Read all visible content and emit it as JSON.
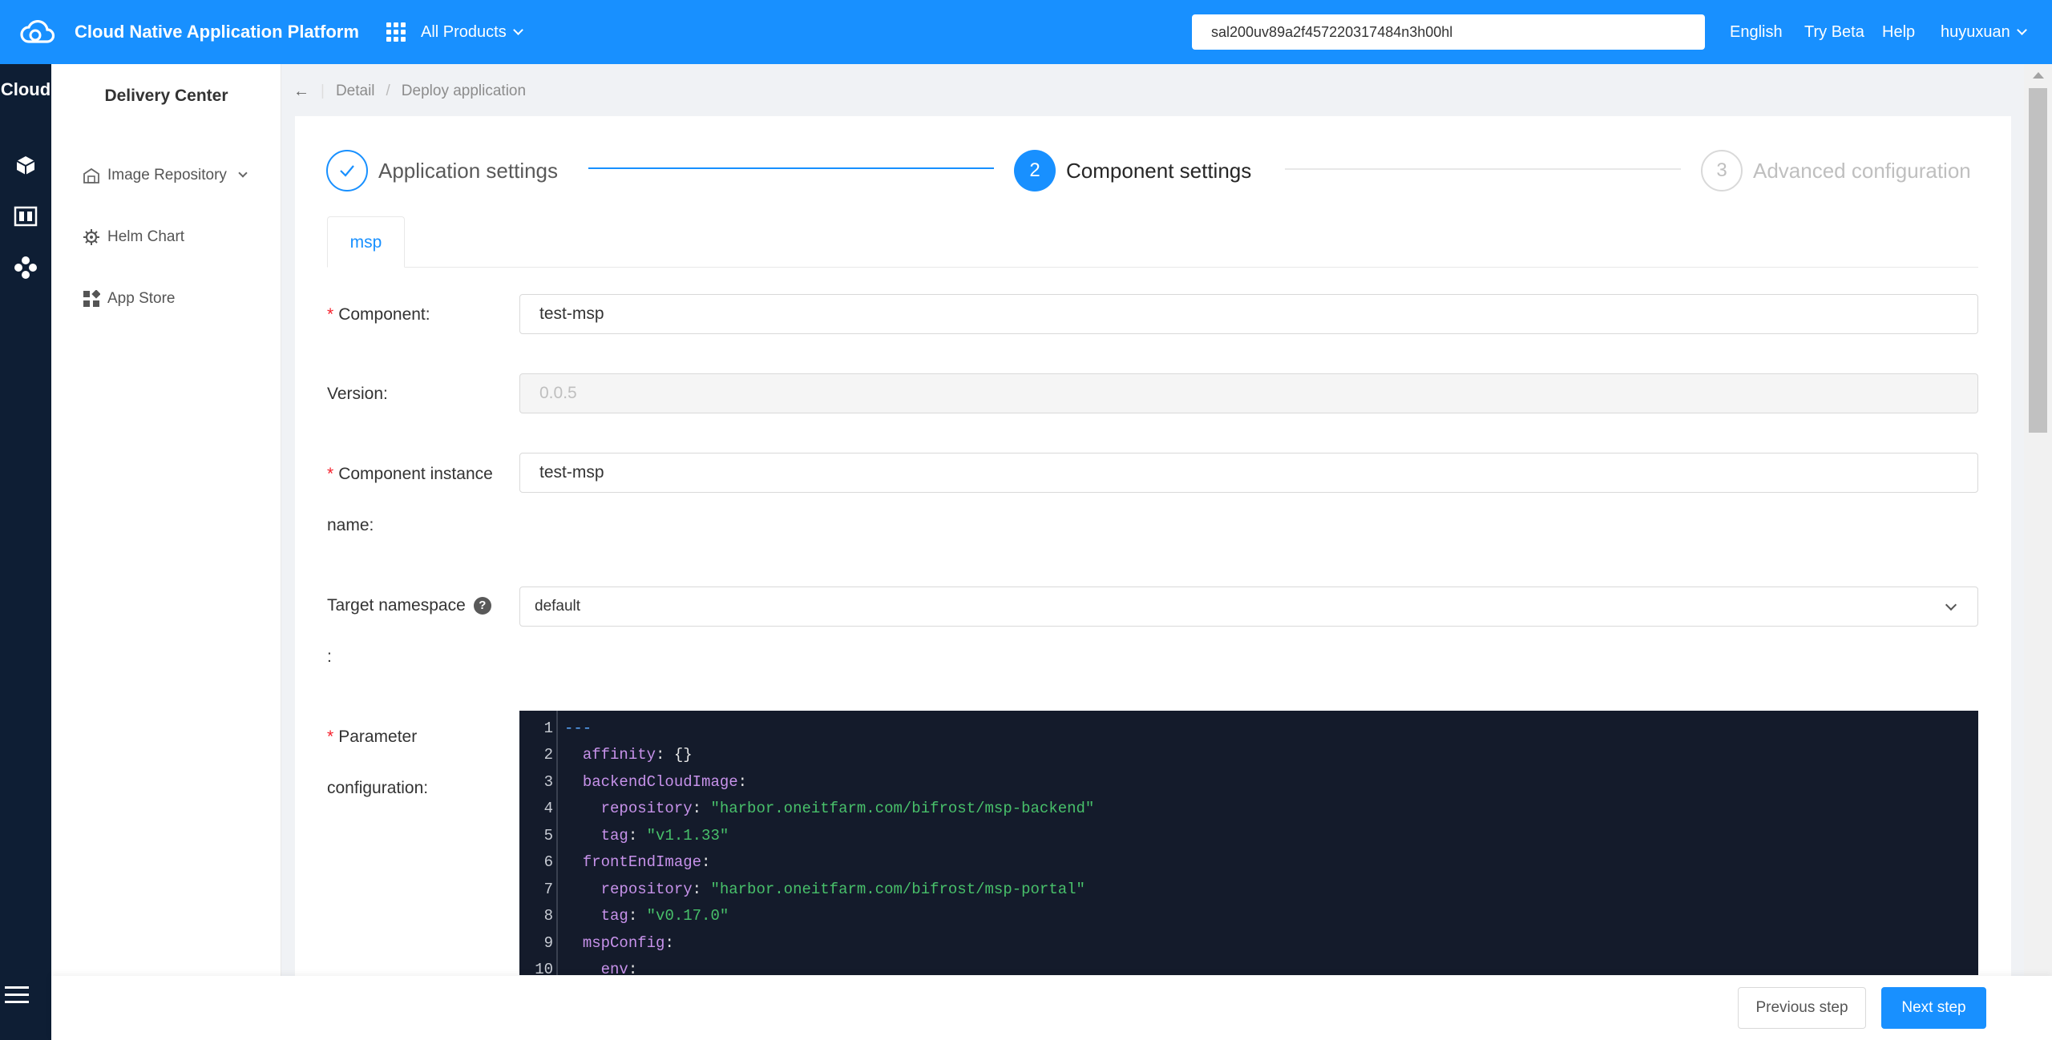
{
  "topbar": {
    "title": "Cloud Native Application Platform",
    "products_label": "All Products",
    "search_value": "sal200uv89a2f457220317484n3h00hl",
    "language": "English",
    "try_beta": "Try Beta",
    "help": "Help",
    "user": "huyuxuan",
    "color": "#1890ff"
  },
  "rail": {
    "title": "Cloud",
    "icons": [
      "cube-icon",
      "dashboard-icon",
      "nodes-icon"
    ]
  },
  "subnav": {
    "title": "Delivery Center",
    "items": [
      {
        "label": "Image Repository",
        "icon": "warehouse-icon"
      },
      {
        "label": "Helm Chart",
        "icon": "helm-icon"
      },
      {
        "label": "App Store",
        "icon": "apps-icon"
      }
    ]
  },
  "breadcrumb": {
    "back": "←",
    "items": [
      "Detail",
      "Deploy application"
    ]
  },
  "steps": [
    {
      "index": "1",
      "label": "Application settings",
      "state": "done"
    },
    {
      "index": "2",
      "label": "Component settings",
      "state": "active"
    },
    {
      "index": "3",
      "label": "Advanced configuration",
      "state": "pending"
    }
  ],
  "tabs": [
    {
      "label": "msp"
    }
  ],
  "form": {
    "component": {
      "label": "Component:",
      "value": "test-msp"
    },
    "version": {
      "label": "Version:",
      "value": "0.0.5"
    },
    "instance": {
      "label_line1": "Component instance",
      "label_line2": "name:",
      "value": "test-msp"
    },
    "namespace": {
      "label_line1": "Target namespace",
      "label_line2": ":",
      "value": "default"
    },
    "params": {
      "label_line1": "Parameter",
      "label_line2": "configuration:"
    }
  },
  "editor": {
    "line_numbers": [
      "1",
      "2",
      "3",
      "4",
      "5",
      "6",
      "7",
      "8",
      "9",
      "10"
    ],
    "lines": [
      {
        "indent": "",
        "key": "---",
        "sep": "",
        "val": ""
      },
      {
        "indent": "  ",
        "key": "affinity",
        "sep": ": ",
        "val": "{}"
      },
      {
        "indent": "  ",
        "key": "backendCloudImage",
        "sep": ":",
        "val": ""
      },
      {
        "indent": "    ",
        "key": "repository",
        "sep": ": ",
        "val": "\"harbor.oneitfarm.com/bifrost/msp-backend\""
      },
      {
        "indent": "    ",
        "key": "tag",
        "sep": ": ",
        "val": "\"v1.1.33\""
      },
      {
        "indent": "  ",
        "key": "frontEndImage",
        "sep": ":",
        "val": ""
      },
      {
        "indent": "    ",
        "key": "repository",
        "sep": ": ",
        "val": "\"harbor.oneitfarm.com/bifrost/msp-portal\""
      },
      {
        "indent": "    ",
        "key": "tag",
        "sep": ": ",
        "val": "\"v0.17.0\""
      },
      {
        "indent": "  ",
        "key": "mspConfig",
        "sep": ":",
        "val": ""
      },
      {
        "indent": "    ",
        "key": "env",
        "sep": ":",
        "val": ""
      }
    ]
  },
  "footer": {
    "previous": "Previous step",
    "next": "Next step"
  }
}
